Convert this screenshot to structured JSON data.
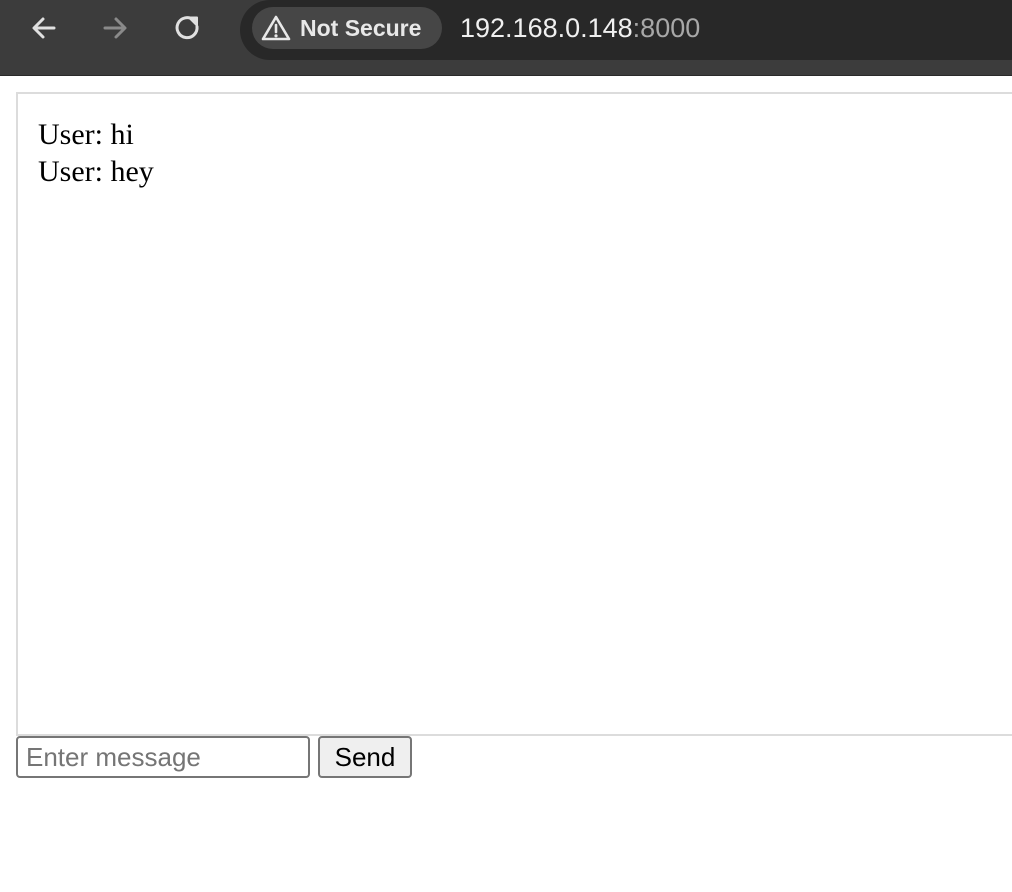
{
  "browser": {
    "security_label": "Not Secure",
    "url_host": "192.168.0.148",
    "url_port": ":8000"
  },
  "chat": {
    "messages": [
      "User: hi",
      "User: hey"
    ]
  },
  "composer": {
    "placeholder": "Enter message",
    "value": "",
    "send_label": "Send"
  }
}
